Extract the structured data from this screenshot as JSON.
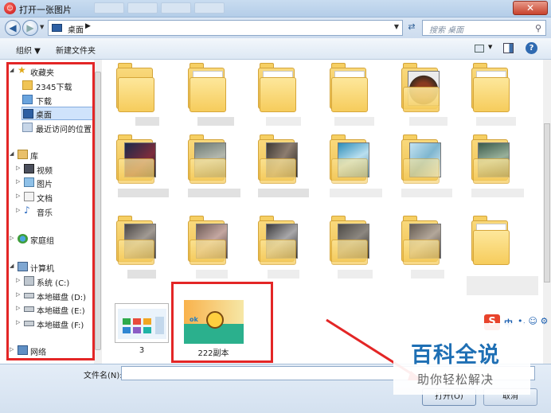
{
  "window": {
    "title": "打开一张图片",
    "close_glyph": "✕"
  },
  "address": {
    "location": "桌面",
    "search_placeholder": "搜索 桌面"
  },
  "toolbar": {
    "organize_label": "组织 ▼",
    "new_folder_label": "新建文件夹",
    "help_glyph": "?"
  },
  "nav": {
    "favorites_label": "收藏夹",
    "downloads_2345_label": "2345下载",
    "downloads_label": "下载",
    "desktop_label": "桌面",
    "recent_label": "最近访问的位置",
    "libraries_label": "库",
    "videos_label": "视频",
    "pictures_label": "图片",
    "documents_label": "文档",
    "music_label": "音乐",
    "homegroup_label": "家庭组",
    "computer_label": "计算机",
    "drive_c_label": "系统 (C:)",
    "drive_d_label": "本地磁盘 (D:)",
    "drive_e_label": "本地磁盘 (E:)",
    "drive_f_label": "本地磁盘 (F:)",
    "network_label": "网络"
  },
  "files": [
    {
      "name": "3"
    },
    {
      "name": "222副本"
    }
  ],
  "footer": {
    "filename_label": "文件名(N):",
    "open_label": "打开(O)",
    "cancel_label": "取消"
  },
  "ime": {
    "logo": "S",
    "mode": "中",
    "extra": "•, ☺ ⚙"
  },
  "watermark": {
    "title": "百科全说",
    "subtitle": "助你轻松解决"
  },
  "colors": {
    "highlight_frame": "#e32626",
    "folder": "#f6cc5c",
    "accent": "#1e6fb4"
  }
}
